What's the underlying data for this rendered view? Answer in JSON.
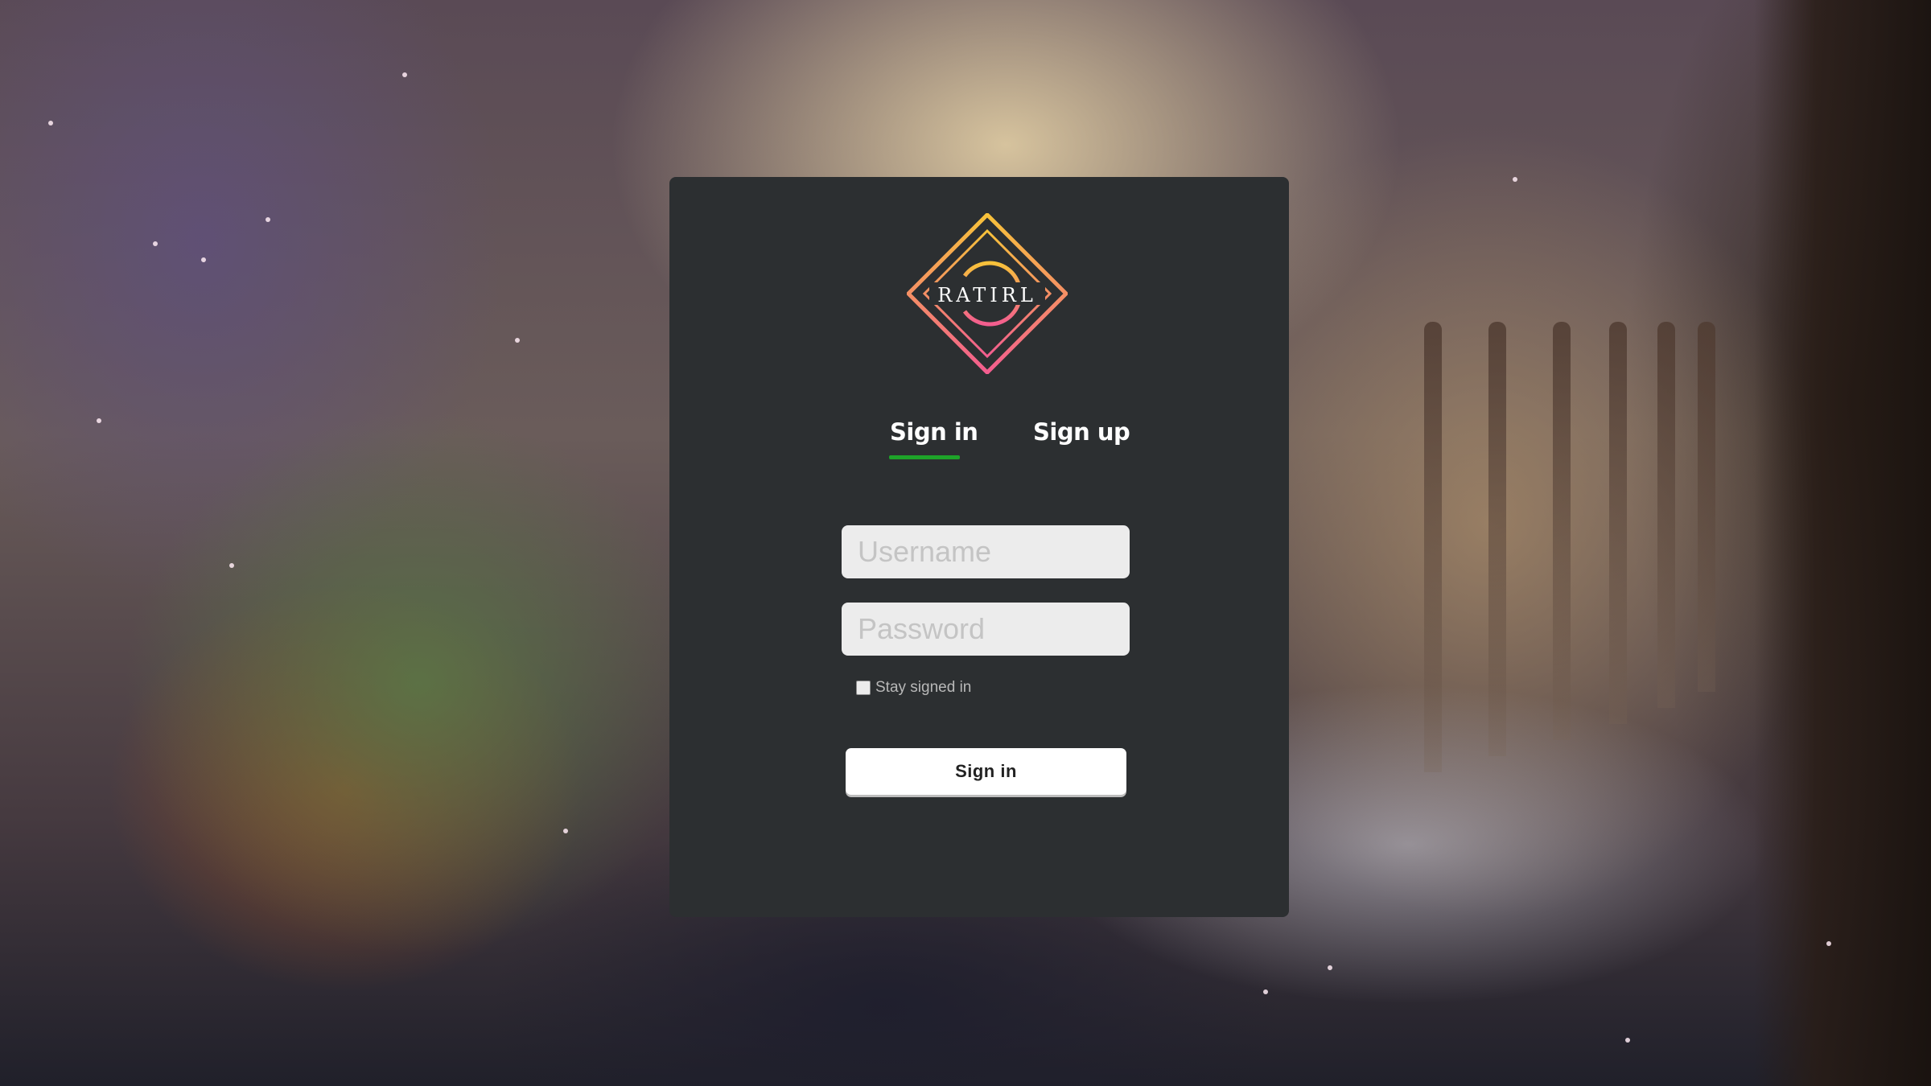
{
  "logo": {
    "text": "RATIRL",
    "icon": "ratirl-diamond-logo",
    "gradient_start": "#f7c23a",
    "gradient_end": "#f35d8f"
  },
  "tabs": [
    {
      "label": "Sign in",
      "active": true
    },
    {
      "label": "Sign up",
      "active": false
    }
  ],
  "form": {
    "username_placeholder": "Username",
    "username_value": "",
    "password_placeholder": "Password",
    "password_value": "",
    "remember_label": "Stay signed in",
    "remember_checked": false,
    "submit_label": "Sign in"
  },
  "colors": {
    "panel_bg": "#2c2f31",
    "active_tab_underline": "#1ea329",
    "input_bg": "#ececec",
    "button_bg": "#ffffff"
  }
}
